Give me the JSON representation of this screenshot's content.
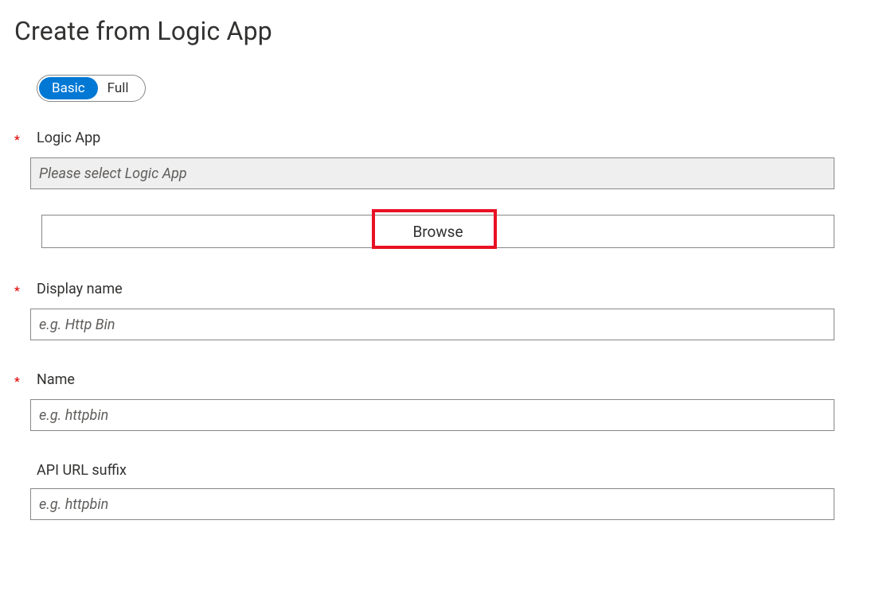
{
  "page": {
    "title": "Create from Logic App"
  },
  "toggle": {
    "basic": "Basic",
    "full": "Full"
  },
  "required_marker": "*",
  "fields": {
    "logic_app": {
      "label": "Logic App",
      "placeholder": "Please select Logic App",
      "required": true
    },
    "display_name": {
      "label": "Display name",
      "placeholder": "e.g. Http Bin",
      "required": true
    },
    "name": {
      "label": "Name",
      "placeholder": "e.g. httpbin",
      "required": true
    },
    "api_url_suffix": {
      "label": "API URL suffix",
      "placeholder": "e.g. httpbin",
      "required": false
    }
  },
  "browse": {
    "label": "Browse"
  }
}
